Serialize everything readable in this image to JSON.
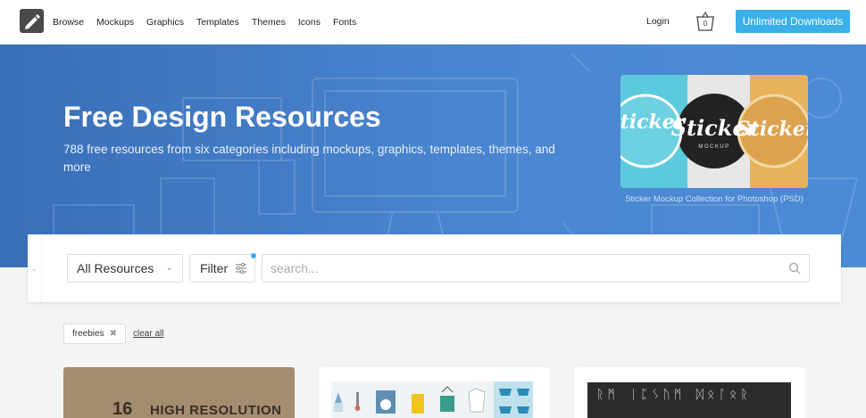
{
  "header": {
    "nav": [
      "Browse",
      "Mockups",
      "Graphics",
      "Templates",
      "Themes",
      "Icons",
      "Fonts"
    ],
    "login_label": "Login",
    "cart_count": "0",
    "cta_label": "Unlimited Downloads"
  },
  "hero": {
    "title": "Free Design Resources",
    "subtitle": "788 free resources from six categories including mockups, graphics, templates, themes, and more",
    "featured": {
      "caption": "Sticker Mockup Collection for Photoshop (PSD)",
      "sticker_word": "Sticker",
      "sticker_sub": "MOCKUP"
    }
  },
  "filters": {
    "category_select": "All Resources",
    "filter_label": "Filter",
    "search_placeholder": "search..."
  },
  "tags": {
    "active": "freebies",
    "clear_label": "clear all"
  },
  "cards": {
    "c1_big": "16",
    "c1_text": "HIGH RESOLUTION",
    "c3_text": "ᚱᛗ ᛁᛈᛊᚢᛗ ᛞᛟᛚᛟᚱ"
  },
  "colors": {
    "accent": "#3ab0ea",
    "hero_bg": "#4a86d0"
  }
}
